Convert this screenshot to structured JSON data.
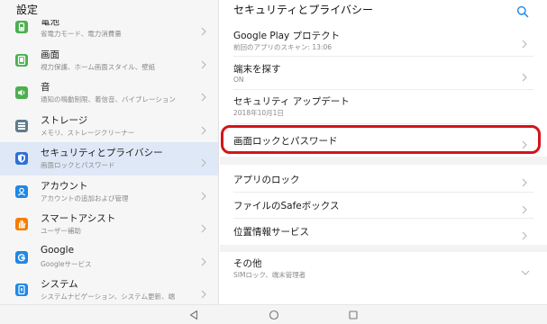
{
  "left_pane": {
    "header": "設定",
    "items": [
      {
        "title": "電池",
        "subtitle": "省電力モード、電力消費量",
        "icon": "battery-icon",
        "color": "#4caf50"
      },
      {
        "title": "画面",
        "subtitle": "視力保護、ホーム画面スタイル、壁紙",
        "icon": "display-icon",
        "color": "#4caf50"
      },
      {
        "title": "音",
        "subtitle": "通知の鳴動制限、着信音、バイブレーション",
        "icon": "sound-icon",
        "color": "#4caf50"
      },
      {
        "title": "ストレージ",
        "subtitle": "メモリ、ストレージクリーナー",
        "icon": "storage-icon",
        "color": "#607d8b"
      },
      {
        "title": "セキュリティとプライバシー",
        "subtitle": "画面ロックとパスワード",
        "icon": "shield-icon",
        "color": "#2f6fd6",
        "active": true
      },
      {
        "title": "アカウント",
        "subtitle": "アカウントの追加および管理",
        "icon": "account-icon",
        "color": "#1e88e5"
      },
      {
        "title": "スマートアシスト",
        "subtitle": "ユーザー補助",
        "icon": "hand-icon",
        "color": "#f57c00"
      },
      {
        "title": "Google",
        "subtitle": "Googleサービス",
        "icon": "google-icon",
        "color": "#1e88e5"
      },
      {
        "title": "システム",
        "subtitle": "システムナビゲーション、システム更新、端",
        "icon": "system-icon",
        "color": "#1e88e5"
      }
    ]
  },
  "right_pane": {
    "title": "セキュリティとプライバシー",
    "search_icon": "search-icon",
    "accent": "#1e88e5",
    "group1": [
      {
        "title": "Google Play プロテクト",
        "subtitle": "前回のアプリのスキャン: 13:06"
      },
      {
        "title": "端末を探す",
        "subtitle": "ON"
      },
      {
        "title": "セキュリティ アップデート",
        "subtitle": "2018年10月1日"
      },
      {
        "title": "画面ロックとパスワード",
        "subtitle": ""
      }
    ],
    "group2": [
      {
        "title": "アプリのロック"
      },
      {
        "title": "ファイルのSafeボックス"
      },
      {
        "title": "位置情報サービス"
      }
    ],
    "group3": [
      {
        "title": "その他",
        "subtitle": "SIMロック、端末管理者"
      }
    ]
  },
  "navbar": {
    "back_icon": "back-triangle-icon",
    "home_icon": "home-circle-icon",
    "recents_icon": "recents-square-icon"
  },
  "highlight_color": "#d4141a"
}
